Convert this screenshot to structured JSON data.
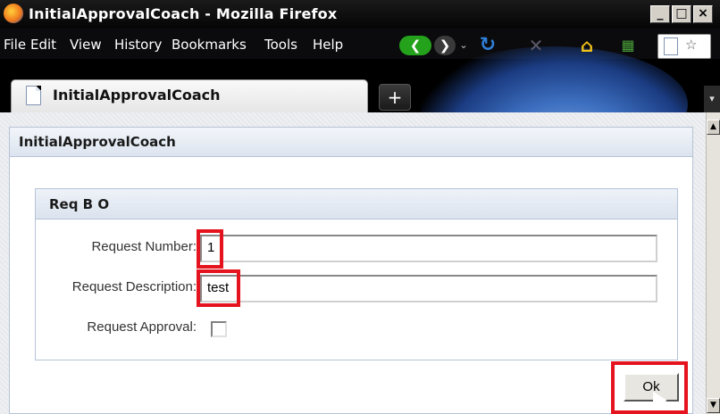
{
  "window": {
    "title": "InitialApprovalCoach - Mozilla Firefox"
  },
  "menu": {
    "items": [
      "File",
      "Edit",
      "View",
      "History",
      "Bookmarks",
      "Tools",
      "Help"
    ]
  },
  "tab": {
    "label": "InitialApprovalCoach",
    "new_tab_symbol": "+"
  },
  "page": {
    "coach_title": "InitialApprovalCoach",
    "section_title": "Req B O",
    "fields": {
      "request_number": {
        "label": "Request Number:",
        "value": "1"
      },
      "request_description": {
        "label": "Request Description:",
        "value": "test"
      },
      "request_approval": {
        "label": "Request Approval:",
        "checked": false
      }
    },
    "ok_label": "Ok"
  },
  "colors": {
    "highlight": "#e4131d",
    "panel_border": "#b6c3d6"
  },
  "icons": [
    "firefox-logo-icon",
    "back-icon",
    "forward-icon",
    "reload-icon",
    "stop-icon",
    "home-icon",
    "bookmark-icon",
    "page-icon"
  ]
}
